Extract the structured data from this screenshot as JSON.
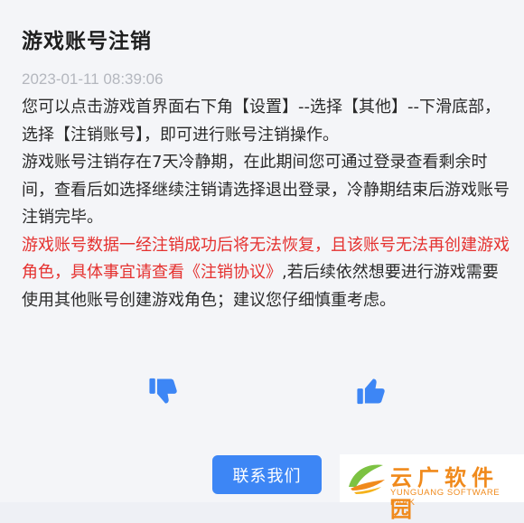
{
  "header": {
    "title": "游戏账号注销",
    "timestamp": "2023-01-11 08:39:06"
  },
  "content": {
    "para1": "您可以点击游戏首界面右下角【设置】--选择【其他】--下滑底部，选择【注销账号】，即可进行账号注销操作。",
    "para2": "游戏账号注销存在7天冷静期，在此期间您可通过登录查看剩余时间，查看后如选择继续注销请选择退出登录，冷静期结束后游戏账号注销完毕。",
    "para3_warning": "游戏账号数据一经注销成功后将无法恢复，且该账号无法再创建游戏角色，具体事宜请查看《注销协议》",
    "para3_rest": ",若后续依然想要进行游戏需要使用其他账号创建游戏角色；建议您仔细慎重考虑。"
  },
  "feedback": {
    "dislike_icon": "thumbs-down-icon",
    "like_icon": "thumbs-up-icon"
  },
  "actions": {
    "contact_label": "联系我们"
  },
  "watermark": {
    "title": "云广软件园",
    "subtitle": "YUNGUANG SOFTWARE PARK"
  },
  "colors": {
    "accent": "#3d86f5",
    "warning": "#e5312f",
    "watermark": "#f08a1c"
  }
}
